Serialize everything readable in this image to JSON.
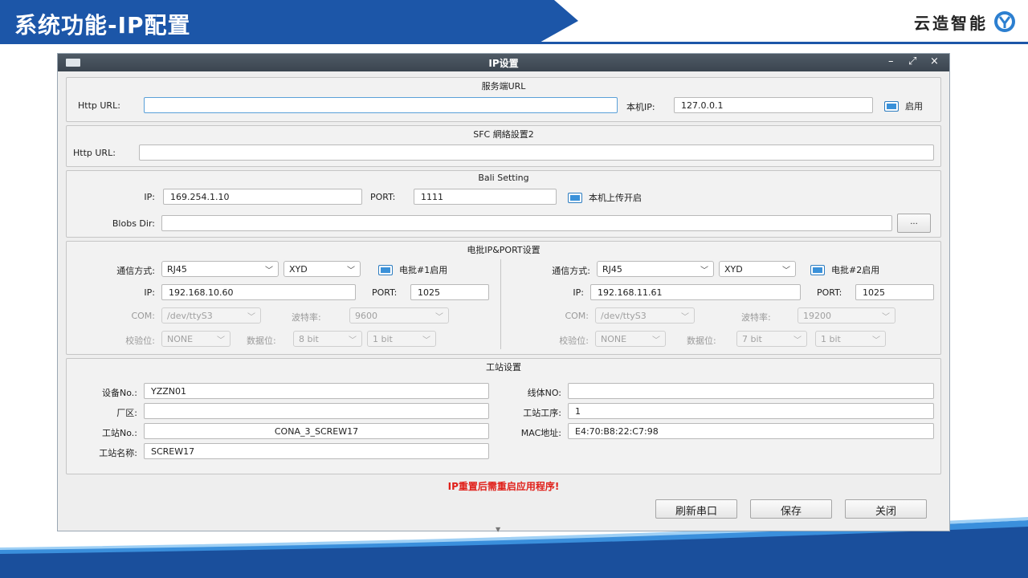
{
  "slide": {
    "title": "系统功能-IP配置",
    "logo_text": "云造智能",
    "header_color": "#1c56a8"
  },
  "window": {
    "title": "IP设置",
    "controls": {
      "minimize": "–",
      "restore": "⤢",
      "close": "×"
    }
  },
  "server_url": {
    "title": "服务端URL",
    "http_url_label": "Http URL:",
    "http_url_value": "",
    "local_ip_label": "本机IP:",
    "local_ip_value": "127.0.0.1",
    "enable_label": "启用"
  },
  "sfc": {
    "title": "SFC 網絡設置2",
    "http_url_label": "Http URL:",
    "http_url_value": ""
  },
  "bali": {
    "title": "Bali Setting",
    "ip_label": "IP:",
    "ip_value": "169.254.1.10",
    "port_label": "PORT:",
    "port_value": "1111",
    "upload_label": "本机上传开启",
    "blobs_label": "Blobs Dir:",
    "blobs_value": "",
    "browse_label": "..."
  },
  "battery": {
    "title": "电批IP&PORT设置",
    "left": {
      "comm_label": "通信方式:",
      "comm_value": "RJ45",
      "proto_value": "XYD",
      "enable_label": "电批#1启用",
      "ip_label": "IP:",
      "ip_value": "192.168.10.60",
      "port_label": "PORT:",
      "port_value": "1025",
      "com_label": "COM:",
      "com_value": "/dev/ttyS3",
      "baud_label": "波特率:",
      "baud_value": "9600",
      "parity_label": "校验位:",
      "parity_value": "NONE",
      "databits_label": "数据位:",
      "databits_value": "8 bit",
      "stopbits_value": "1 bit"
    },
    "right": {
      "comm_label": "通信方式:",
      "comm_value": "RJ45",
      "proto_value": "XYD",
      "enable_label": "电批#2启用",
      "ip_label": "IP:",
      "ip_value": "192.168.11.61",
      "port_label": "PORT:",
      "port_value": "1025",
      "com_label": "COM:",
      "com_value": "/dev/ttyS3",
      "baud_label": "波特率:",
      "baud_value": "19200",
      "parity_label": "校验位:",
      "parity_value": "NONE",
      "databits_label": "数据位:",
      "databits_value": "7 bit",
      "stopbits_value": "1 bit"
    }
  },
  "station": {
    "title": "工站设置",
    "device_no_label": "设备No.:",
    "device_no_value": "YZZN01",
    "factory_label": "厂区:",
    "factory_value": "",
    "station_no_label": "工站No.:",
    "station_no_value": "CONA_3_SCREW17",
    "station_name_label": "工站名称:",
    "station_name_value": "SCREW17",
    "line_no_label": "线体NO:",
    "line_no_value": "",
    "process_label": "工站工序:",
    "process_value": "1",
    "mac_label": "MAC地址:",
    "mac_value": "E4:70:B8:22:C7:98"
  },
  "warning": "IP重置后需重启应用程序!",
  "buttons": {
    "refresh": "刷新串口",
    "save": "保存",
    "close": "关闭"
  }
}
